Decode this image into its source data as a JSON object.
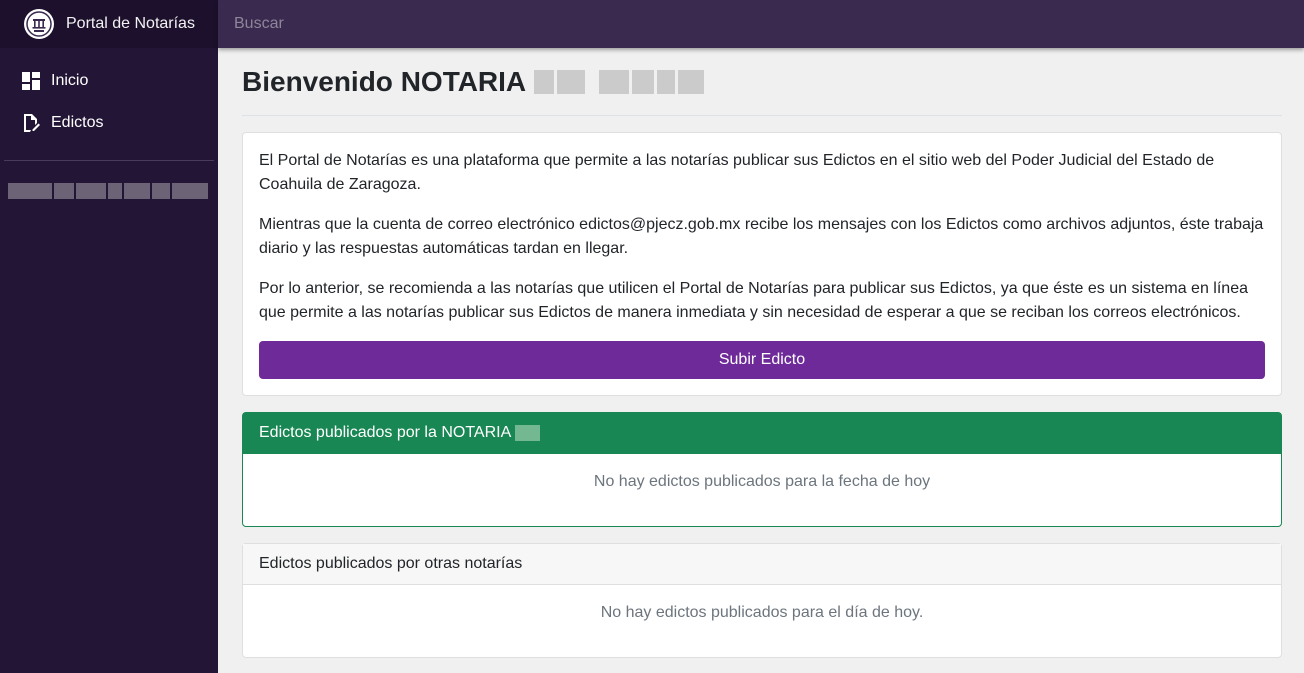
{
  "brand": {
    "title": "Portal de Notarías",
    "logo_icon": "pjecz-seal-icon"
  },
  "search": {
    "placeholder": "Buscar"
  },
  "sidebar": {
    "items": [
      {
        "label": "Inicio",
        "icon": "dashboard-icon"
      },
      {
        "label": "Edictos",
        "icon": "file-edit-icon"
      }
    ]
  },
  "main": {
    "title": "Bienvenido NOTARIA",
    "intro": {
      "paragraphs": [
        "El Portal de Notarías es una plataforma que permite a las notarías publicar sus Edictos en el sitio web del Poder Judicial del Estado de Coahuila de Zaragoza.",
        "Mientras que la cuenta de correo electrónico edictos@pjecz.gob.mx recibe los mensajes con los Edictos como archivos adjuntos, éste trabaja diario y las respuestas automáticas tardan en llegar.",
        "Por lo anterior, se recomienda a las notarías que utilicen el Portal de Notarías para publicar sus Edictos, ya que éste es un sistema en línea que permite a las notarías publicar sus Edictos de manera inmediata y sin necesidad de esperar a que se reciban los correos electrónicos."
      ],
      "button_label": "Subir Edicto"
    },
    "own_edicts": {
      "header": "Edictos publicados por la NOTARIA",
      "empty_message": "No hay edictos publicados para la fecha de hoy"
    },
    "other_edicts": {
      "header": "Edictos publicados por otras notarías",
      "empty_message": "No hay edictos publicados para el día de hoy."
    }
  },
  "colors": {
    "sidebar_bg": "#231536",
    "topbar_bg": "#3a2a50",
    "primary_button": "#6f2a9a",
    "success_header": "#198754"
  }
}
